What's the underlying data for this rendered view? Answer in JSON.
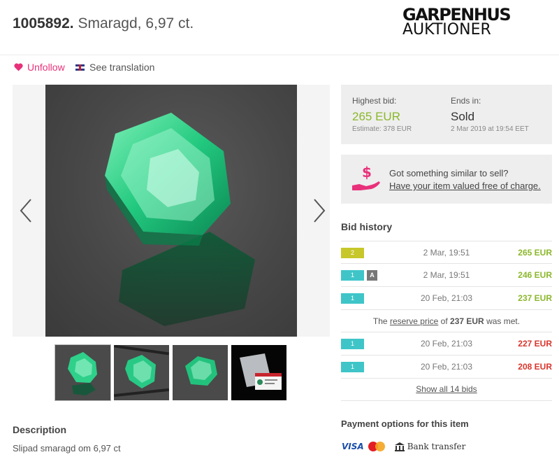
{
  "lot": {
    "number": "1005892.",
    "name": "Smaragd, 6,97 ct."
  },
  "logo": {
    "line1": "GARPENHUS",
    "line2": "AUKTIONER"
  },
  "actions": {
    "follow_label": "Unfollow",
    "translate_label": "See translation"
  },
  "bid_summary": {
    "highest_bid_label": "Highest bid:",
    "highest_bid_value": "265 EUR",
    "estimate": "Estimate: 378 EUR",
    "ends_label": "Ends in:",
    "status": "Sold",
    "end_time": "2 Mar 2019 at 19:54 EET"
  },
  "sell": {
    "question": "Got something similar to sell?",
    "link": "Have your item valued free of charge."
  },
  "bid_history": {
    "title": "Bid history",
    "rows": [
      {
        "badge": "2",
        "extra": "",
        "date": "2 Mar, 19:51",
        "amount": "265 EUR"
      },
      {
        "badge": "1",
        "extra": "A",
        "date": "2 Mar, 19:51",
        "amount": "246 EUR"
      },
      {
        "badge": "1",
        "extra": "",
        "date": "20 Feb, 21:03",
        "amount": "237 EUR"
      },
      {
        "badge": "1",
        "extra": "",
        "date": "20 Feb, 21:03",
        "amount": "227 EUR"
      },
      {
        "badge": "1",
        "extra": "",
        "date": "20 Feb, 21:03",
        "amount": "208 EUR"
      }
    ],
    "reserve": {
      "prefix": "The",
      "link": "reserve price",
      "mid": "of",
      "amount": "237 EUR",
      "suffix": "was met."
    },
    "show_all": "Show all 14 bids"
  },
  "description": {
    "title": "Description",
    "text": "Slipad smaragd om 6,97 ct"
  },
  "payment": {
    "title": "Payment options for this item",
    "visa": "VISA",
    "bank": "Bank transfer"
  },
  "colors": {
    "accent_pink": "#e8317a",
    "price_green": "#8bb72a",
    "bid_red": "#d9342b",
    "badge_teal": "#3fc5c8",
    "badge_olive": "#c7c72a"
  }
}
